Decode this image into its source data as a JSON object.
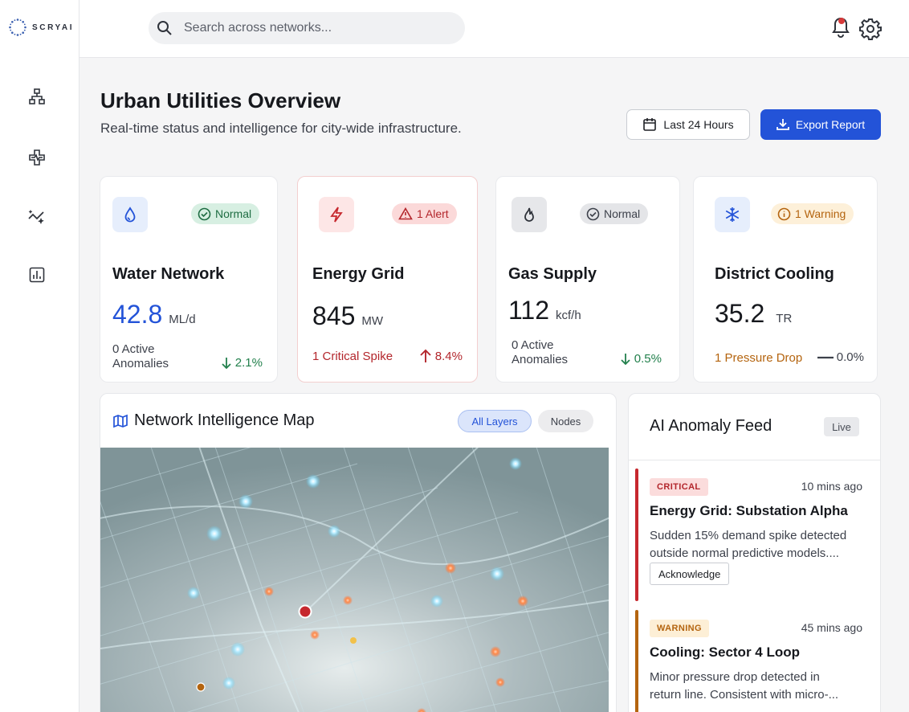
{
  "brand": {
    "name": "SCRYAI"
  },
  "sidebar": {
    "items": [
      {
        "icon": "hierarchy-icon"
      },
      {
        "icon": "health-cross-icon"
      },
      {
        "icon": "sparkle-trend-icon"
      },
      {
        "icon": "bar-chart-icon"
      }
    ]
  },
  "search": {
    "placeholder": "Search across networks..."
  },
  "header": {
    "title": "Urban Utilities Overview",
    "subtitle": "Real-time status and intelligence for city-wide infrastructure.",
    "range_label": "Last 24 Hours",
    "export_label": "Export Report"
  },
  "cards": [
    {
      "name": "Water Network",
      "value": "42.8",
      "unit": "ML/d",
      "status": "Normal",
      "note": "0 Active Anomalies",
      "trend": "2.1%",
      "trend_dir": "down"
    },
    {
      "name": "Energy Grid",
      "value": "845",
      "unit": "MW",
      "status": "1 Alert",
      "note": "1 Critical Spike",
      "trend": "8.4%",
      "trend_dir": "up"
    },
    {
      "name": "Gas Supply",
      "value": "112",
      "unit": "kcf/h",
      "status": "Normal",
      "note": "0 Active Anomalies",
      "trend": "0.5%",
      "trend_dir": "down"
    },
    {
      "name": "District Cooling",
      "value": "35.2",
      "unit": "TR",
      "status": "1 Warning",
      "note": "1 Pressure Drop",
      "trend": "0.0%",
      "trend_dir": "flat"
    }
  ],
  "map": {
    "title": "Network Intelligence Map",
    "chips": [
      "All Layers",
      "Nodes"
    ],
    "active_chip": "All Layers"
  },
  "feed": {
    "title": "AI Anomaly Feed",
    "live_label": "Live",
    "items": [
      {
        "level": "CRITICAL",
        "time": "10 mins ago",
        "title": "Energy Grid: Substation Alpha",
        "body_line1": "Sudden 15% demand spike detected",
        "body_line2": "outside normal predictive models....",
        "action": "Acknowledge"
      },
      {
        "level": "WARNING",
        "time": "45 mins ago",
        "title": "Cooling: Sector 4 Loop",
        "body_line1": "Minor pressure drop detected in",
        "body_line2": "return line. Consistent with micro-..."
      }
    ]
  },
  "colors": {
    "accent": "#2353d8",
    "critical": "#c6282e",
    "warning": "#b4640f",
    "success": "#22804c"
  }
}
